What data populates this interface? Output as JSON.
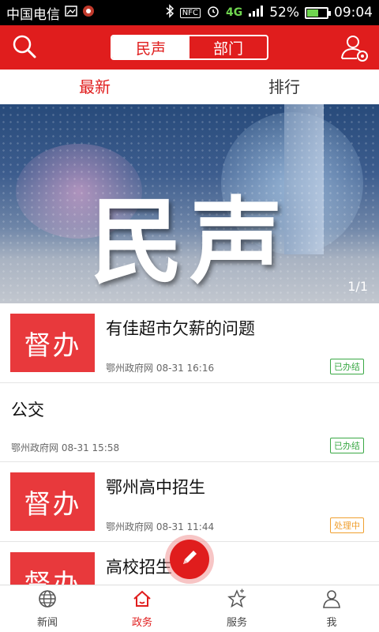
{
  "status_bar": {
    "carrier": "中国电信",
    "nfc": "NFC",
    "net_4g": "4G",
    "battery_percent": "52%",
    "battery_level": 0.52,
    "time": "09:04"
  },
  "header": {
    "segments": [
      "民声",
      "部门"
    ],
    "active_segment": "民声"
  },
  "tabs": [
    {
      "label": "最新",
      "active": true
    },
    {
      "label": "排行",
      "active": false
    }
  ],
  "banner": {
    "title": "民声",
    "pager": "1/1"
  },
  "list": [
    {
      "title": "有佳超市欠薪的问题",
      "has_image": true,
      "image_label": "督办",
      "source": "鄂州政府网",
      "time": "08-31 16:16",
      "status": "已办结",
      "status_color": "#3aa845"
    },
    {
      "title": "公交",
      "has_image": false,
      "source": "鄂州政府网",
      "time": "08-31 15:58",
      "status": "已办结",
      "status_color": "#3aa845"
    },
    {
      "title": "鄂州高中招生",
      "has_image": true,
      "image_label": "督办",
      "source": "鄂州政府网",
      "time": "08-31 11:44",
      "status": "处理中",
      "status_color": "#f0a030"
    },
    {
      "title": "高校招生",
      "has_image": true,
      "image_label": "督办",
      "source": "",
      "time": "",
      "status": "",
      "status_color": "#f0a030"
    }
  ],
  "bottom_nav": [
    {
      "label": "新闻",
      "icon": "globe-icon",
      "active": false
    },
    {
      "label": "政务",
      "icon": "home-icon",
      "active": true
    },
    {
      "label": "服务",
      "icon": "star-icon",
      "active": false
    },
    {
      "label": "我",
      "icon": "person-icon",
      "active": false
    }
  ],
  "colors": {
    "brand_red": "#e01d1d",
    "thumb_red": "#e8393c"
  }
}
